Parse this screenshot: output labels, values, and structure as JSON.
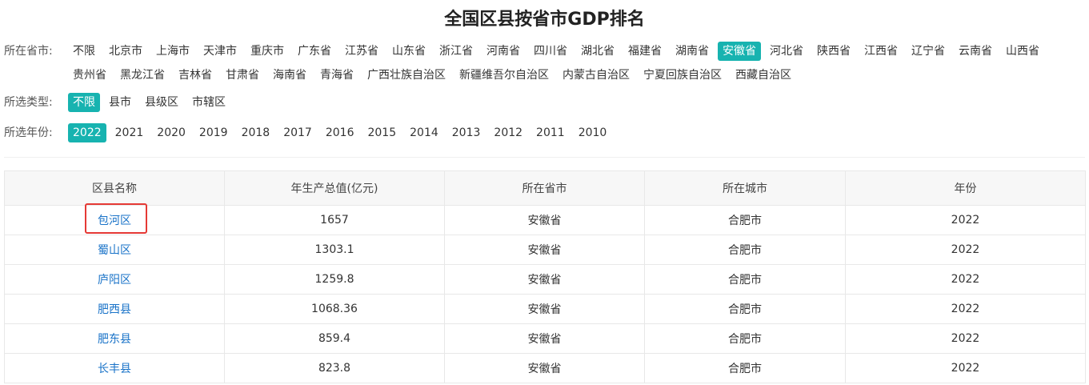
{
  "title": "全国区县按省市GDP排名",
  "filters": {
    "province_label": "所在省市:",
    "provinces": [
      "不限",
      "北京市",
      "上海市",
      "天津市",
      "重庆市",
      "广东省",
      "江苏省",
      "山东省",
      "浙江省",
      "河南省",
      "四川省",
      "湖北省",
      "福建省",
      "湖南省",
      "安徽省",
      "河北省",
      "陕西省",
      "江西省",
      "辽宁省",
      "云南省",
      "山西省",
      "贵州省",
      "黑龙江省",
      "吉林省",
      "甘肃省",
      "海南省",
      "青海省",
      "广西壮族自治区",
      "新疆维吾尔自治区",
      "内蒙古自治区",
      "宁夏回族自治区",
      "西藏自治区"
    ],
    "province_active": "安徽省",
    "type_label": "所选类型:",
    "types": [
      "不限",
      "县市",
      "县级区",
      "市辖区"
    ],
    "type_active": "不限",
    "year_label": "所选年份:",
    "years": [
      "2022",
      "2021",
      "2020",
      "2019",
      "2018",
      "2017",
      "2016",
      "2015",
      "2014",
      "2013",
      "2012",
      "2011",
      "2010"
    ],
    "year_active": "2022"
  },
  "table": {
    "headers": [
      "区县名称",
      "年生产总值(亿元)",
      "所在省市",
      "所在城市",
      "年份"
    ],
    "rows": [
      [
        "包河区",
        "1657",
        "安徽省",
        "合肥市",
        "2022"
      ],
      [
        "蜀山区",
        "1303.1",
        "安徽省",
        "合肥市",
        "2022"
      ],
      [
        "庐阳区",
        "1259.8",
        "安徽省",
        "合肥市",
        "2022"
      ],
      [
        "肥西县",
        "1068.36",
        "安徽省",
        "合肥市",
        "2022"
      ],
      [
        "肥东县",
        "859.4",
        "安徽省",
        "合肥市",
        "2022"
      ],
      [
        "长丰县",
        "823.8",
        "安徽省",
        "合肥市",
        "2022"
      ]
    ]
  },
  "colors": {
    "accent": "#17b3b0",
    "link": "#1a73c8",
    "highlight": "#e53935"
  }
}
